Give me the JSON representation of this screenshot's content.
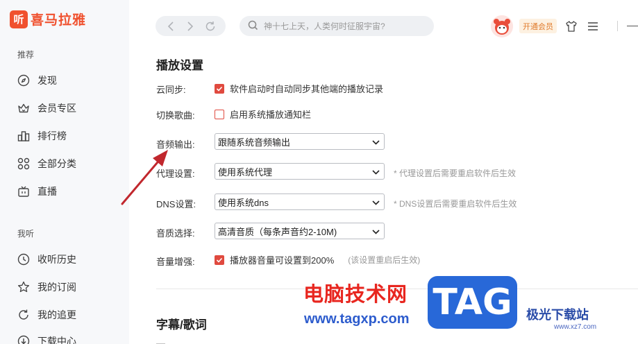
{
  "app": {
    "logo_mark": "听",
    "logo_text": "喜马拉雅"
  },
  "sidebar": {
    "section_recommend": "推荐",
    "items_recommend": [
      {
        "label": "发现",
        "icon": "compass-icon"
      },
      {
        "label": "会员专区",
        "icon": "vip-crown-icon"
      },
      {
        "label": "排行榜",
        "icon": "ranking-icon"
      },
      {
        "label": "全部分类",
        "icon": "category-grid-icon"
      },
      {
        "label": "直播",
        "icon": "tv-live-icon"
      }
    ],
    "section_mine": "我听",
    "items_mine": [
      {
        "label": "收听历史",
        "icon": "clock-icon"
      },
      {
        "label": "我的订阅",
        "icon": "star-icon"
      },
      {
        "label": "我的追更",
        "icon": "refresh-icon"
      },
      {
        "label": "下载中心",
        "icon": "download-icon"
      }
    ]
  },
  "header": {
    "search_placeholder": "神十七上天，人类何时征服宇宙?",
    "vip_label": "开通会员"
  },
  "playback": {
    "title": "播放设置",
    "cloud_sync": {
      "label": "云同步:",
      "checkbox_label": "软件启动时自动同步其他端的播放记录",
      "checked": true
    },
    "switch_song": {
      "label": "切换歌曲:",
      "checkbox_label": "启用系统播放通知栏",
      "checked": false
    },
    "audio_output": {
      "label": "音频输出:",
      "value": "跟随系统音频输出"
    },
    "proxy": {
      "label": "代理设置:",
      "value": "使用系统代理",
      "note": "* 代理设置后需要重启软件后生效"
    },
    "dns": {
      "label": "DNS设置:",
      "value": "使用系统dns",
      "note": "* DNS设置后需要重启软件后生效"
    },
    "quality": {
      "label": "音质选择:",
      "value": "高清音质（每条声音约2-10M)"
    },
    "volume_boost": {
      "label": "音量增强:",
      "checkbox_label": "播放器音量可设置到200%",
      "hint": "(该设置重启后生效)",
      "checked": true
    }
  },
  "lyrics": {
    "title": "字幕/歌词"
  },
  "watermark": {
    "cn_text": "电脑技术网",
    "url": "www.tagxp.com",
    "tag": "TAG",
    "site_name": "极光下载站",
    "site_url": "www.xz7.com"
  },
  "colors": {
    "brand": "#f0512e",
    "checkbox": "#e04a3f",
    "arrow": "#c1272d"
  }
}
